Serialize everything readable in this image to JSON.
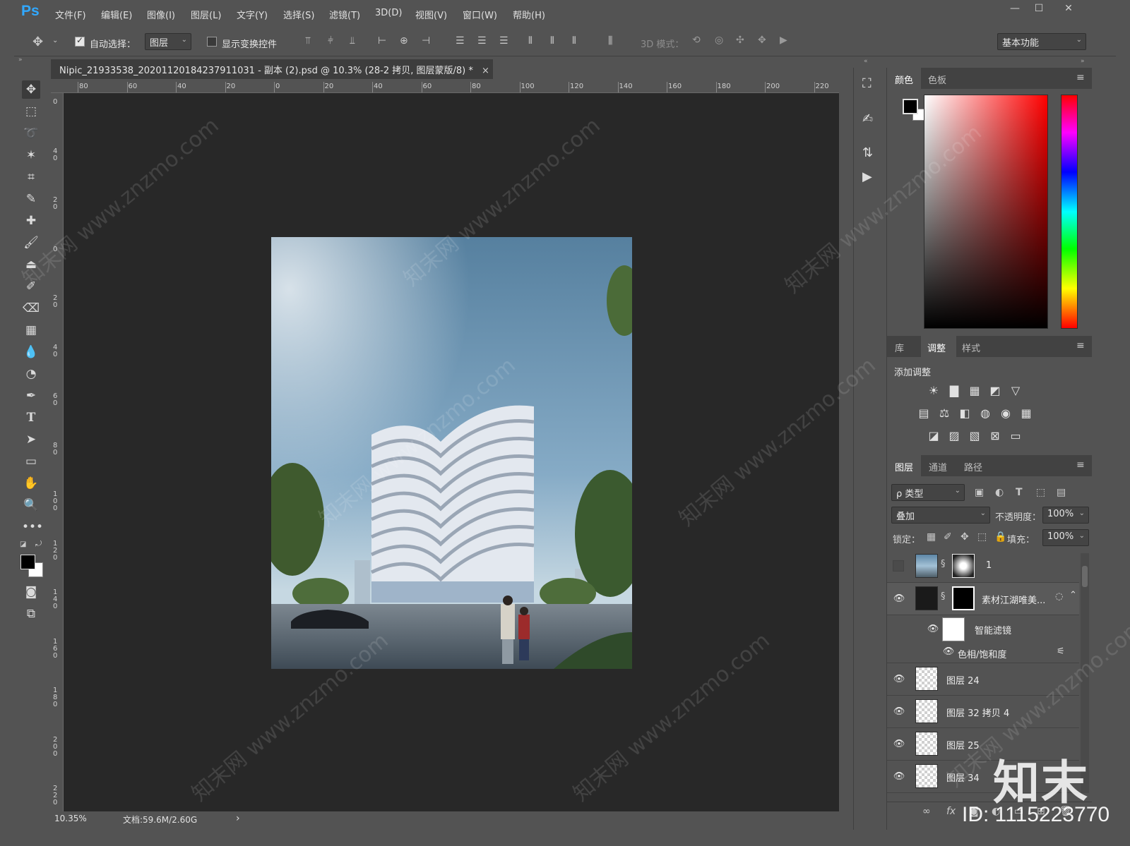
{
  "app": {
    "logo": "Ps"
  },
  "menubar": {
    "items": [
      "文件(F)",
      "编辑(E)",
      "图像(I)",
      "图层(L)",
      "文字(Y)",
      "选择(S)",
      "滤镜(T)",
      "3D(D)",
      "视图(V)",
      "窗口(W)",
      "帮助(H)"
    ],
    "window_controls": [
      "—",
      "☐",
      "✕"
    ]
  },
  "options": {
    "auto_select_label": "自动选择：",
    "auto_select_checked": true,
    "auto_select_target": "图层",
    "show_transform_label": "显示变换控件",
    "show_transform_checked": false,
    "mode_3d_label": "3D 模式：",
    "workspace": "基本功能"
  },
  "document": {
    "tab_title": "Nipic_21933538_20201120184237911031 - 副本 (2).psd @ 10.3% (28-2 拷贝, 图层蒙版/8) *",
    "tab_close": "×",
    "ruler_top": [
      "80",
      "60",
      "40",
      "20",
      "0",
      "20",
      "40",
      "60",
      "80",
      "100",
      "120",
      "140",
      "160",
      "180",
      "200",
      "220"
    ],
    "ruler_left": [
      "0",
      "4 0",
      "2 0",
      "0",
      "2 0",
      "4 0",
      "6 0",
      "8 0",
      "1 0 0",
      "1 2 0",
      "1 4 0",
      "1 6 0",
      "1 8 0",
      "2 0 0",
      "2 2 0"
    ],
    "zoom": "10.35%",
    "doc_size": "文档:59.6M/2.60G",
    "status_arrow": "›"
  },
  "color_panel": {
    "tabs": [
      "颜色",
      "色板"
    ],
    "active": "颜色",
    "fg": "#000000",
    "bg": "#ffffff",
    "hue": "#ff0000"
  },
  "adjust_panel": {
    "tabs": [
      "库",
      "调整",
      "样式"
    ],
    "active": "调整",
    "title": "添加调整",
    "row1": [
      "☀",
      "▇",
      "▦",
      "◩",
      "▽"
    ],
    "row2": [
      "▤",
      "⚖",
      "◧",
      "◍",
      "◉",
      "▦"
    ],
    "row3": [
      "◪",
      "▨",
      "▧",
      "⊠",
      "▭"
    ]
  },
  "layers_panel": {
    "tabs": [
      "图层",
      "通道",
      "路径"
    ],
    "active": "图层",
    "filter_kind": "ρ 类型",
    "blend_mode": "叠加",
    "opacity_label": "不透明度：",
    "opacity": "100%",
    "lock_label": "锁定：",
    "fill_label": "填充：",
    "fill": "100%",
    "layers": [
      {
        "name": "1",
        "visible": false
      },
      {
        "name": "素材江湖唯美...",
        "visible": true
      },
      {
        "name": "智能滤镜",
        "visible": true
      },
      {
        "name": "色相/饱和度",
        "visible": true
      },
      {
        "name": "图层 24",
        "visible": true
      },
      {
        "name": "图层 32 拷贝 4",
        "visible": true
      },
      {
        "name": "图层 25",
        "visible": true
      },
      {
        "name": "图层 34",
        "visible": true
      }
    ]
  },
  "watermark": {
    "site": "知末网 www.znzmo.com",
    "brand": "知末",
    "id": "ID: 1115223770"
  }
}
